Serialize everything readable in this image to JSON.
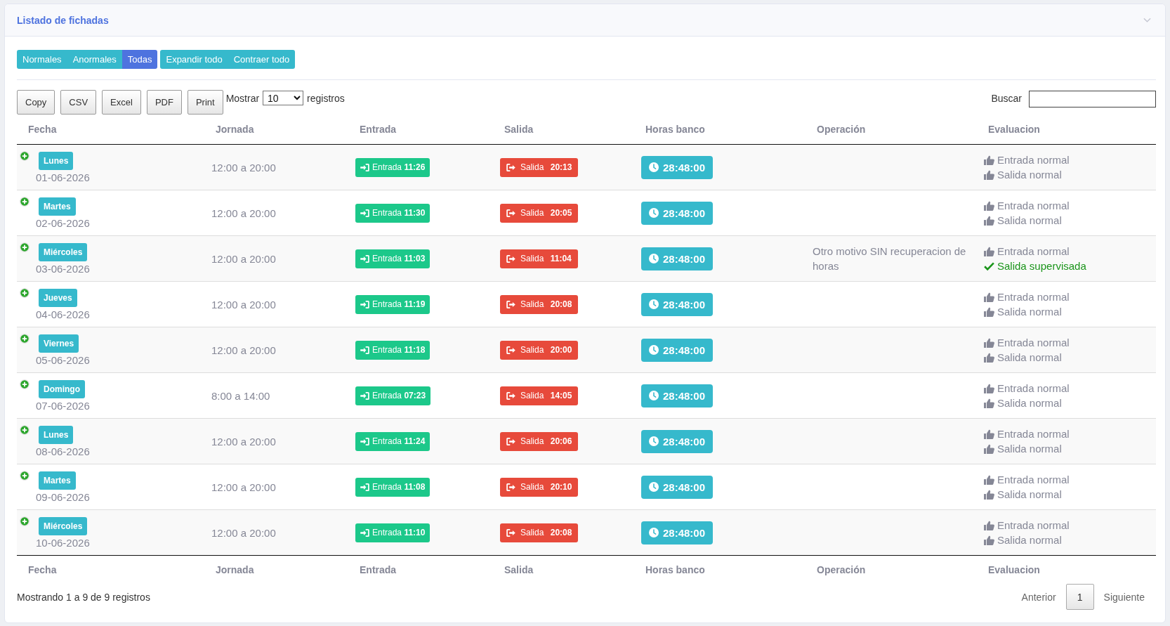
{
  "card": {
    "title": "Listado de fichadas"
  },
  "filters": [
    {
      "label": "Normales",
      "selected": false
    },
    {
      "label": "Anormales",
      "selected": false
    },
    {
      "label": "Todas",
      "selected": true
    }
  ],
  "row_toggle_buttons": [
    "Expandir todo",
    "Contraer todo"
  ],
  "export_buttons": [
    "Copy",
    "CSV",
    "Excel",
    "PDF",
    "Print"
  ],
  "page_length": {
    "label_before": "Mostrar",
    "value": "10",
    "label_after": "registros"
  },
  "search": {
    "label": "Buscar"
  },
  "table": {
    "columns": [
      "Fecha",
      "Jornada",
      "Entrada",
      "Salida",
      "Horas banco",
      "Operación",
      "Evaluacion"
    ],
    "rows": [
      {
        "day": "Lunes",
        "date": "01-06-2026",
        "schedule": "12:00 a 20:00",
        "entry": {
          "label": "Entrada",
          "time": "11:26"
        },
        "exit": {
          "label": "Salida",
          "time": "20:13"
        },
        "bank_hours": "28:48:00",
        "evaluation": [
          {
            "kind": "normal",
            "text": "Entrada normal"
          },
          {
            "kind": "normal",
            "text": "Salida normal"
          }
        ]
      },
      {
        "day": "Martes",
        "date": "02-06-2026",
        "schedule": "12:00 a 20:00",
        "entry": {
          "label": "Entrada",
          "time": "11:30"
        },
        "exit": {
          "label": "Salida",
          "time": "20:05"
        },
        "bank_hours": "28:48:00",
        "evaluation": [
          {
            "kind": "normal",
            "text": "Entrada normal"
          },
          {
            "kind": "normal",
            "text": "Salida normal"
          }
        ]
      },
      {
        "day": "Miércoles",
        "date": "03-06-2026",
        "schedule": "12:00 a 20:00",
        "entry": {
          "label": "Entrada",
          "time": "11:03"
        },
        "exit": {
          "label": "Salida",
          "time": "11:04"
        },
        "bank_hours": "28:48:00",
        "operation": "Otro motivo SIN recuperacion de horas",
        "evaluation": [
          {
            "kind": "normal",
            "text": "Entrada normal"
          },
          {
            "kind": "supervised",
            "text": "Salida supervisada"
          }
        ]
      },
      {
        "day": "Jueves",
        "date": "04-06-2026",
        "schedule": "12:00 a 20:00",
        "entry": {
          "label": "Entrada",
          "time": "11:19"
        },
        "exit": {
          "label": "Salida",
          "time": "20:08"
        },
        "bank_hours": "28:48:00",
        "evaluation": [
          {
            "kind": "normal",
            "text": "Entrada normal"
          },
          {
            "kind": "normal",
            "text": "Salida normal"
          }
        ]
      },
      {
        "day": "Viernes",
        "date": "05-06-2026",
        "schedule": "12:00 a 20:00",
        "entry": {
          "label": "Entrada",
          "time": "11:18"
        },
        "exit": {
          "label": "Salida",
          "time": "20:00"
        },
        "bank_hours": "28:48:00",
        "evaluation": [
          {
            "kind": "normal",
            "text": "Entrada normal"
          },
          {
            "kind": "normal",
            "text": "Salida normal"
          }
        ]
      },
      {
        "day": "Domingo",
        "date": "07-06-2026",
        "schedule": "8:00 a 14:00",
        "entry": {
          "label": "Entrada",
          "time": "07:23"
        },
        "exit": {
          "label": "Salida",
          "time": "14:05"
        },
        "bank_hours": "28:48:00",
        "evaluation": [
          {
            "kind": "normal",
            "text": "Entrada normal"
          },
          {
            "kind": "normal",
            "text": "Salida normal"
          }
        ]
      },
      {
        "day": "Lunes",
        "date": "08-06-2026",
        "schedule": "12:00 a 20:00",
        "entry": {
          "label": "Entrada",
          "time": "11:24"
        },
        "exit": {
          "label": "Salida",
          "time": "20:06"
        },
        "bank_hours": "28:48:00",
        "evaluation": [
          {
            "kind": "normal",
            "text": "Entrada normal"
          },
          {
            "kind": "normal",
            "text": "Salida normal"
          }
        ]
      },
      {
        "day": "Martes",
        "date": "09-06-2026",
        "schedule": "12:00 a 20:00",
        "entry": {
          "label": "Entrada",
          "time": "11:08"
        },
        "exit": {
          "label": "Salida",
          "time": "20:10"
        },
        "bank_hours": "28:48:00",
        "evaluation": [
          {
            "kind": "normal",
            "text": "Entrada normal"
          },
          {
            "kind": "normal",
            "text": "Salida normal"
          }
        ]
      },
      {
        "day": "Miércoles",
        "date": "10-06-2026",
        "schedule": "12:00 a 20:00",
        "entry": {
          "label": "Entrada",
          "time": "11:10"
        },
        "exit": {
          "label": "Salida",
          "time": "20:08"
        },
        "bank_hours": "28:48:00",
        "evaluation": [
          {
            "kind": "normal",
            "text": "Entrada normal"
          },
          {
            "kind": "normal",
            "text": "Salida normal"
          }
        ]
      }
    ],
    "footer_columns": [
      "Fecha",
      "Jornada",
      "Entrada",
      "Salida",
      "Horas banco",
      "Operación",
      "Evaluacion"
    ]
  },
  "info": "Mostrando 1 a 9 de 9 registros",
  "pagination": {
    "previous": "Anterior",
    "pages": [
      {
        "label": "1",
        "selected": true
      }
    ],
    "next": "Siguiente"
  }
}
